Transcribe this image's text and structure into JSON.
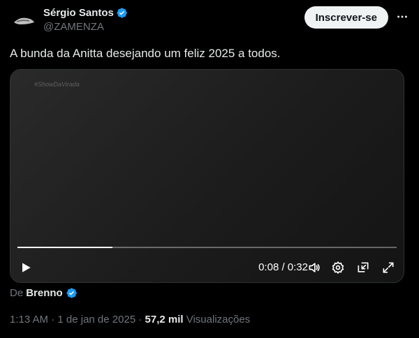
{
  "author": {
    "display_name": "Sérgio Santos",
    "handle": "@ZAMENZA",
    "verified": true
  },
  "follow_label": "Inscrever-se",
  "more_icon": "more-dots-icon",
  "tweet_text": "A bunda da Anitta desejando um feliz 2025 a todos.",
  "media": {
    "watermark": "#ShowDaVirada",
    "progress": 0.25,
    "time": "0:08 / 0:32"
  },
  "attribution": {
    "prefix": "De",
    "name": "Brenno",
    "verified": true
  },
  "meta": {
    "time": "1:13 AM",
    "separator1": "·",
    "date": "1 de jan de 2025",
    "separator2": "·",
    "views_count": "57,2 mil",
    "views_label": "Visualizações"
  },
  "colors": {
    "verified_blue": "#1d9bf0",
    "muted": "#71767b",
    "text": "#e7e9ea"
  }
}
